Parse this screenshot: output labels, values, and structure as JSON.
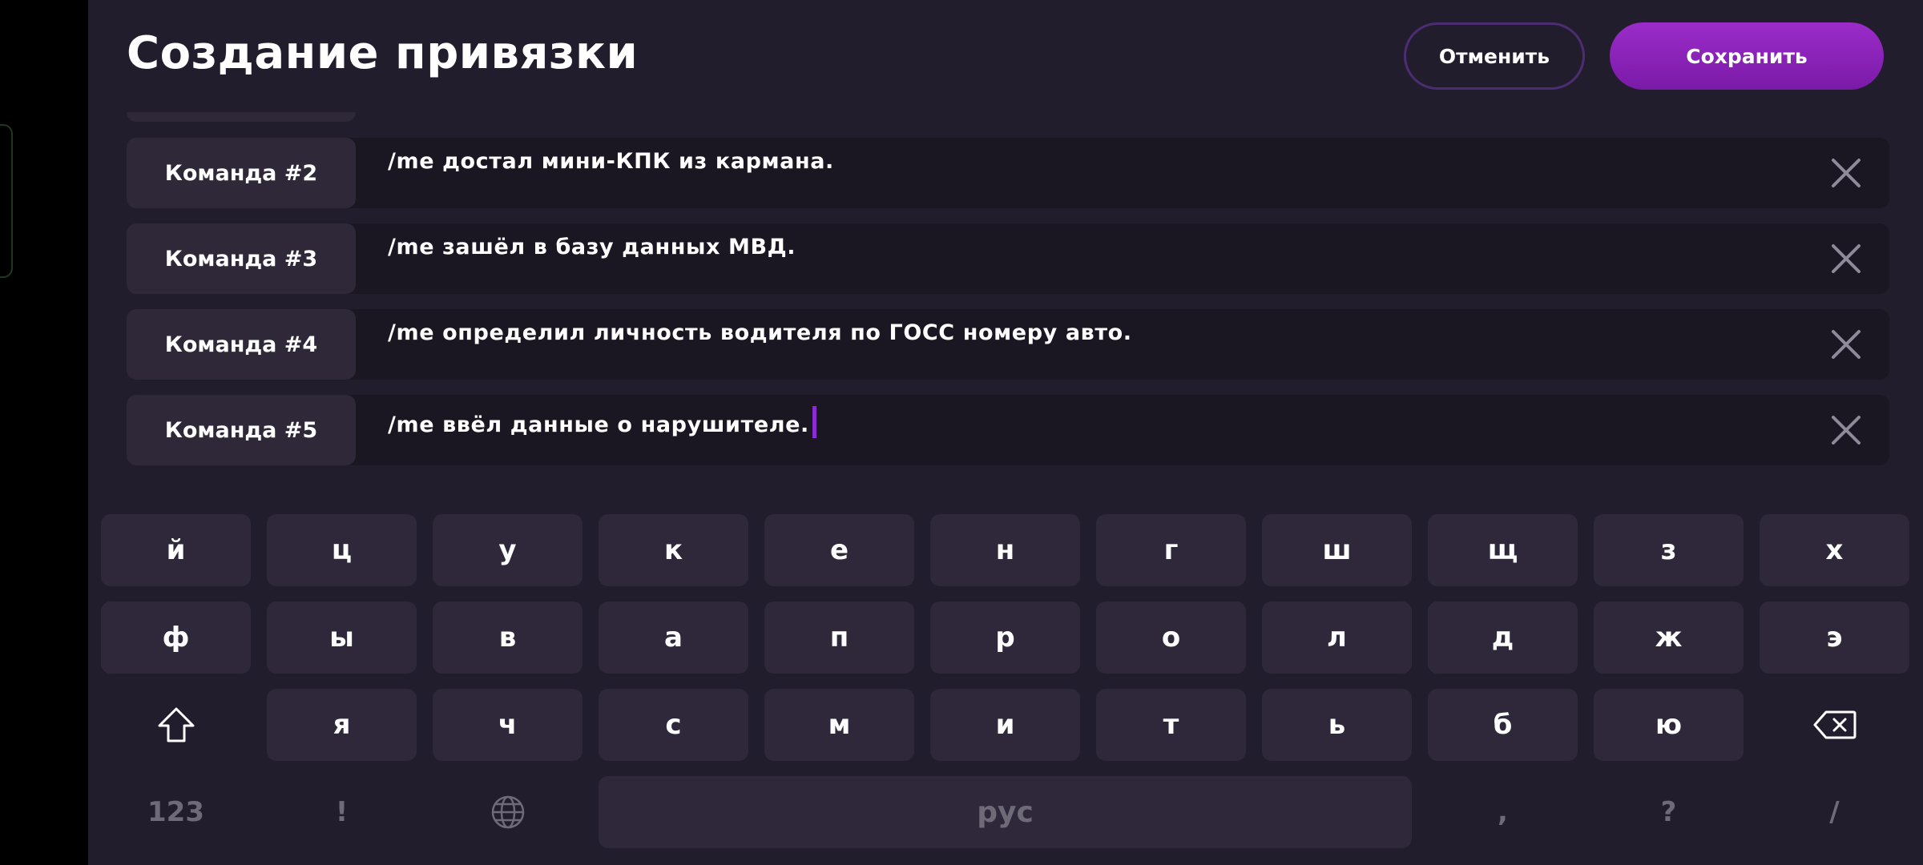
{
  "header": {
    "title": "Создание привязки",
    "cancel_label": "Отменить",
    "save_label": "Сохранить"
  },
  "commands": [
    {
      "label": "Команда #2",
      "text": "/me достал мини-КПК из кармана."
    },
    {
      "label": "Команда #3",
      "text": "/me зашёл в базу данных МВД."
    },
    {
      "label": "Команда #4",
      "text": "/me определил личность водителя по ГОСС номеру авто."
    },
    {
      "label": "Команда #5",
      "text": "/me ввёл данные о нарушителе."
    }
  ],
  "keyboard": {
    "row1": [
      "й",
      "ц",
      "у",
      "к",
      "е",
      "н",
      "г",
      "ш",
      "щ",
      "з",
      "х"
    ],
    "row2": [
      "ф",
      "ы",
      "в",
      "а",
      "п",
      "р",
      "о",
      "л",
      "д",
      "ж",
      "э"
    ],
    "row3": [
      "я",
      "ч",
      "с",
      "м",
      "и",
      "т",
      "ь",
      "б",
      "ю"
    ],
    "numbers_label": "123",
    "exclamation": "!",
    "space_label": "рус",
    "comma": ",",
    "question": "?",
    "slash": "/"
  },
  "colors": {
    "background": "#221d2c",
    "accent": "#8a2bd6",
    "key": "#2f283a",
    "row": "#1a1622"
  },
  "icons": [
    "remove-icon",
    "shift-icon",
    "backspace-icon",
    "globe-icon"
  ]
}
